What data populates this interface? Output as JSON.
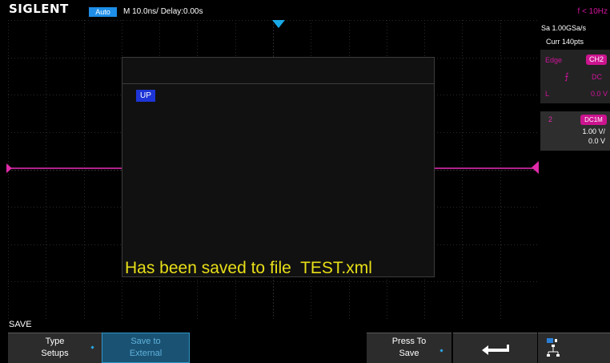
{
  "header": {
    "brand": "SIGLENT",
    "trigger_status": "Auto",
    "timebase": "M 10.0ns/  Delay:0.00s",
    "trigger_frequency": "f < 10Hz"
  },
  "acquisition": {
    "sample_rate": "Sa 1.00GSa/s",
    "memory_depth": "Curr 140pts"
  },
  "trigger": {
    "type": "Edge",
    "source": "CH2",
    "slope_icon": "rising-edge-icon",
    "slope_glyph": "⨍",
    "coupling": "DC",
    "mode": "L",
    "level": "0.0 V"
  },
  "channel": {
    "number": "2",
    "coupling": "DC1M",
    "scale": "1.00 V/",
    "offset": "0.0 V",
    "color": "#e02aa9"
  },
  "dialog": {
    "up_label": "UP",
    "message": "Has been saved to file  TEST.xml"
  },
  "menu": {
    "title": "SAVE",
    "softkeys": [
      {
        "line1": "Type",
        "line2": "Setups"
      },
      {
        "line1": "Save to",
        "line2": "External"
      },
      {
        "line1": "",
        "line2": ""
      },
      {
        "line1": "Press To",
        "line2": "Save"
      },
      {
        "icon": "return-arrow-icon"
      },
      {
        "icon": "network-icon"
      }
    ]
  },
  "colors": {
    "accent_blue": "#1e8ee8",
    "channel_magenta": "#e02aa9",
    "message_yellow": "#e8df18"
  }
}
